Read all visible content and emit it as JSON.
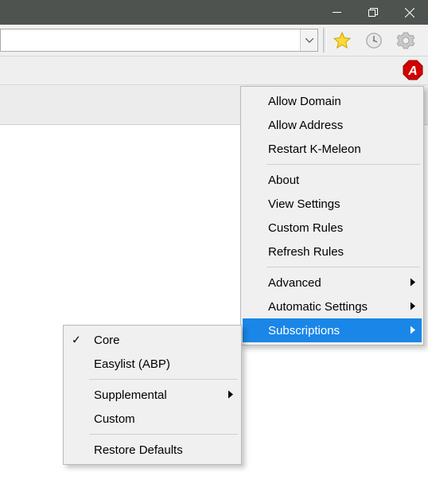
{
  "titlebar": {
    "minimize": "Minimize",
    "maximize": "Maximize",
    "close": "Close"
  },
  "toolbar": {
    "address_value": "",
    "address_placeholder": ""
  },
  "main_menu": {
    "allow_domain": "Allow Domain",
    "allow_address": "Allow Address",
    "restart": "Restart K-Meleon",
    "about": "About",
    "view_settings": "View Settings",
    "custom_rules": "Custom Rules",
    "refresh_rules": "Refresh Rules",
    "advanced": "Advanced",
    "automatic_settings": "Automatic Settings",
    "subscriptions": "Subscriptions"
  },
  "sub_menu": {
    "core": "Core",
    "easylist": "Easylist (ABP)",
    "supplemental": "Supplemental",
    "custom": "Custom",
    "restore_defaults": "Restore Defaults"
  }
}
